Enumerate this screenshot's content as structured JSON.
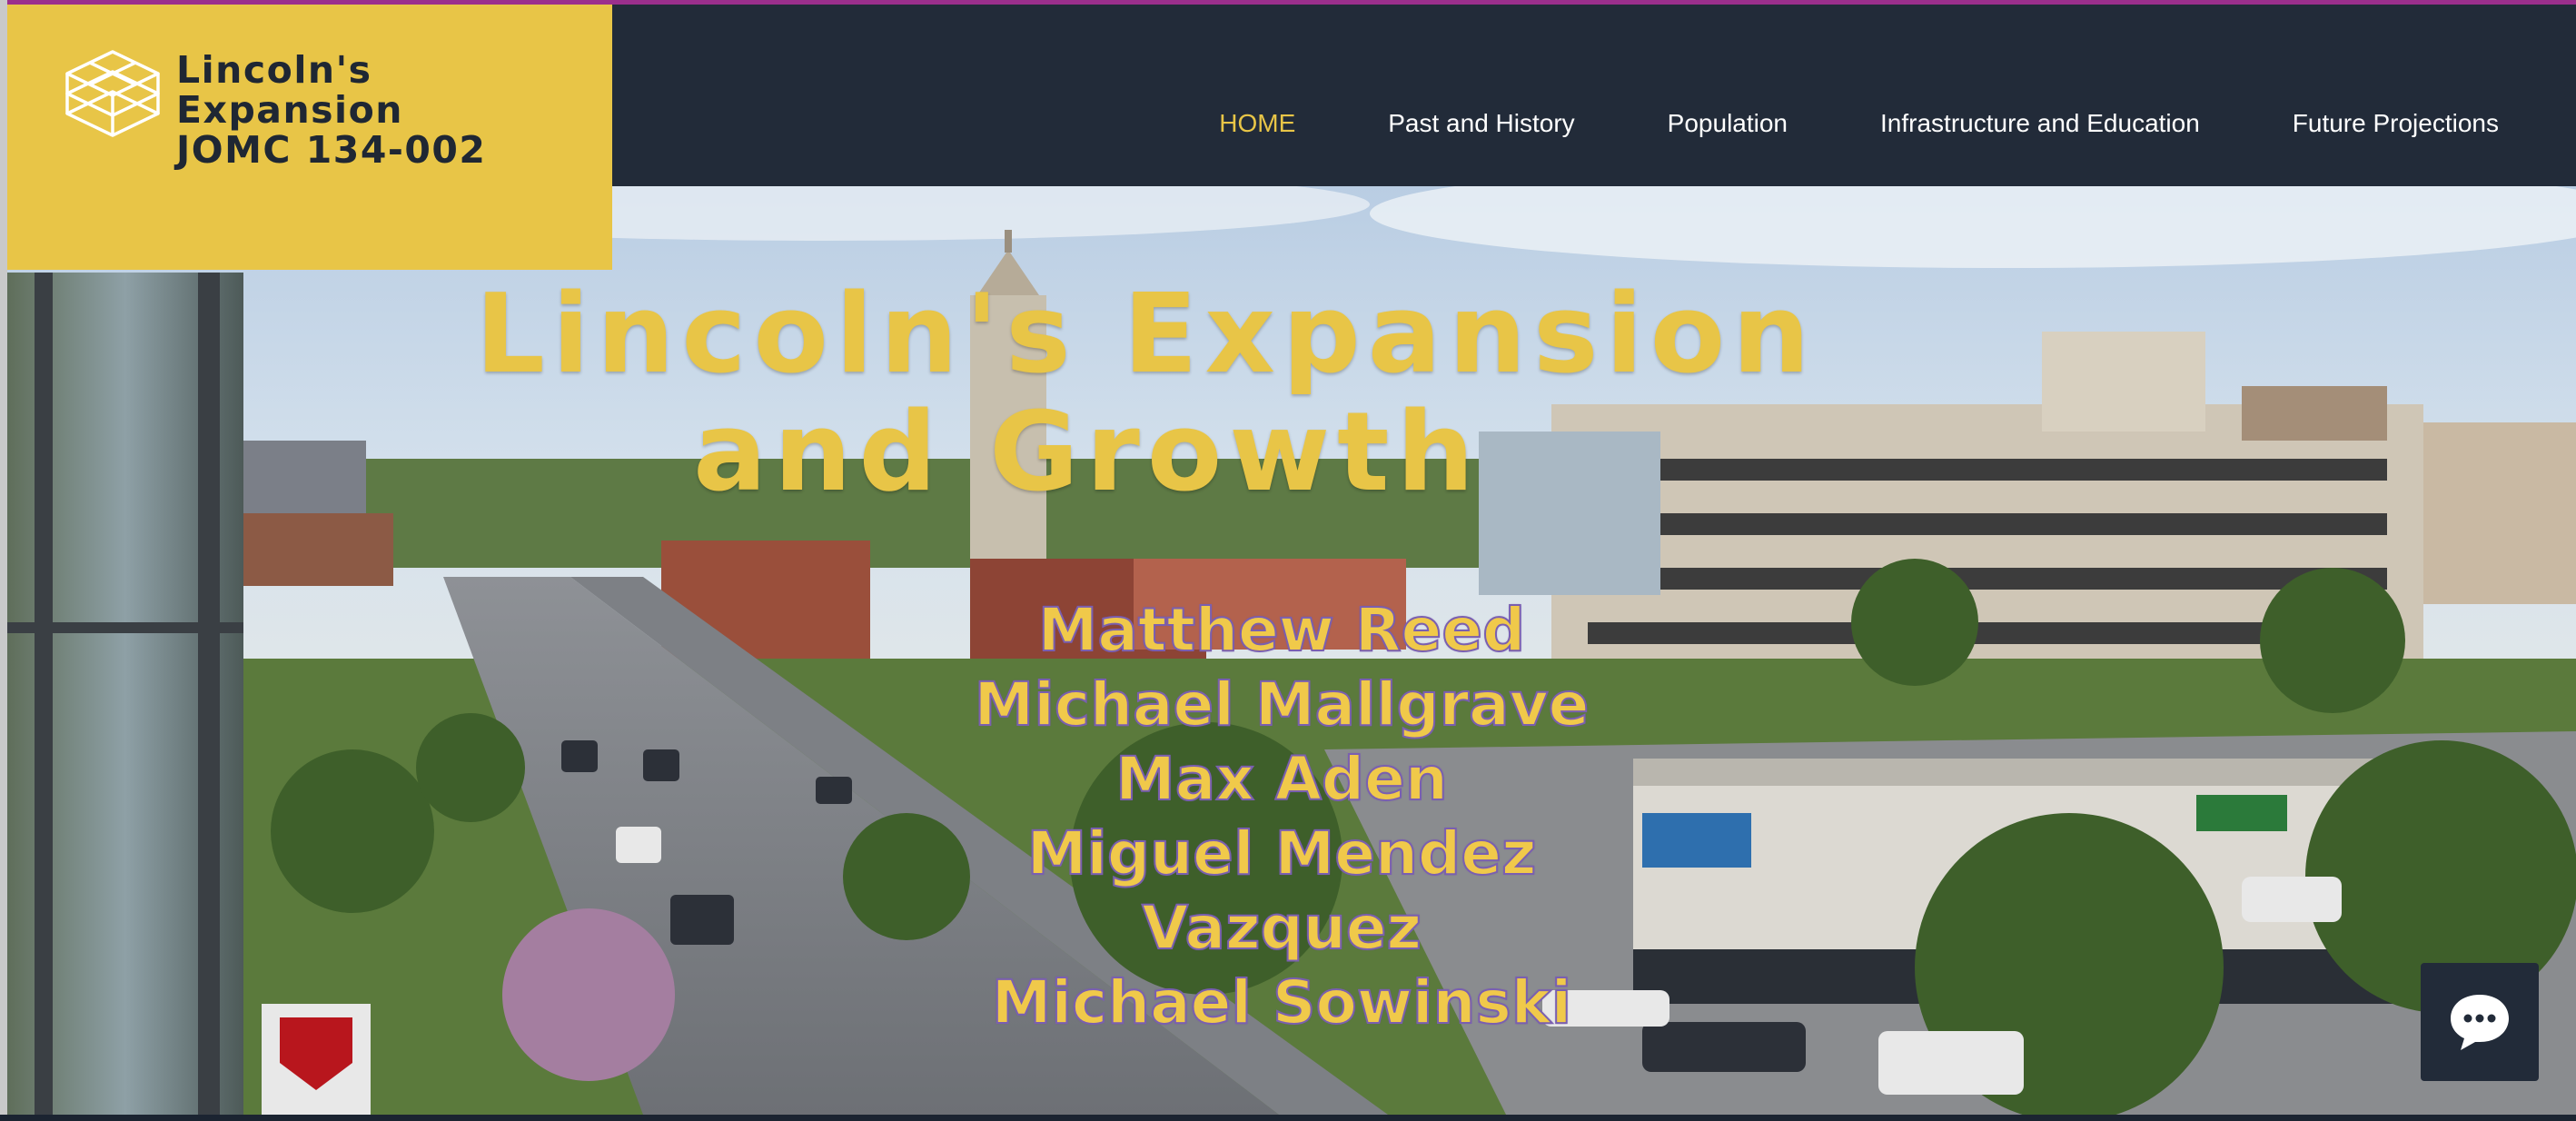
{
  "brand": {
    "line1": "Lincoln's Expansion",
    "line2": "JOMC 134-002",
    "accent_color": "#e8c547",
    "logo_icon": "stacked-layers-icon"
  },
  "nav": {
    "items": [
      {
        "label": "HOME",
        "active": true
      },
      {
        "label": "Past and History",
        "active": false
      },
      {
        "label": "Population",
        "active": false
      },
      {
        "label": "Infrastructure and Education",
        "active": false
      },
      {
        "label": "Future Projections",
        "active": false
      }
    ]
  },
  "hero": {
    "title_line1": "Lincoln's Expansion",
    "title_line2": "and Growth",
    "authors": [
      "Matthew Reed",
      "Michael Mallgrave",
      "Max Aden",
      "Miguel Mendez Vazquez",
      "Michael Sowinski"
    ],
    "background": "aerial-city-street-photo"
  },
  "chat": {
    "icon": "chat-bubble-icon"
  },
  "colors": {
    "header_bg": "#222b39",
    "top_accent": "#9b2f8c"
  }
}
